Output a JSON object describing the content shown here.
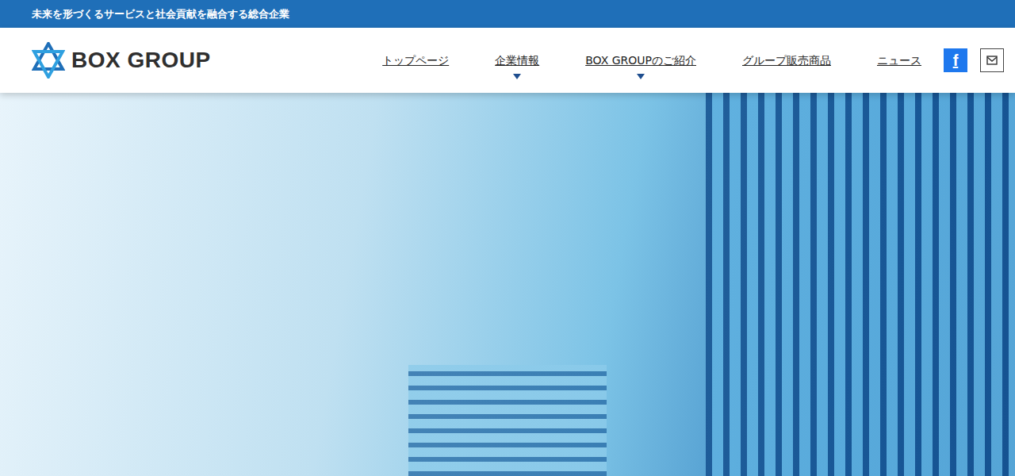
{
  "topbar": {
    "tagline": "未来を形づくるサービスと社会貢献を融合する総合企業"
  },
  "logo": {
    "text": "BOX GROUP"
  },
  "nav": [
    {
      "label": "トップページ",
      "has_dropdown": false
    },
    {
      "label": "企業情報",
      "has_dropdown": true
    },
    {
      "label": "BOX GROUPのご紹介",
      "has_dropdown": true
    },
    {
      "label": "グループ販売商品",
      "has_dropdown": false
    },
    {
      "label": "ニュース",
      "has_dropdown": false
    }
  ],
  "social": {
    "facebook": "f"
  }
}
